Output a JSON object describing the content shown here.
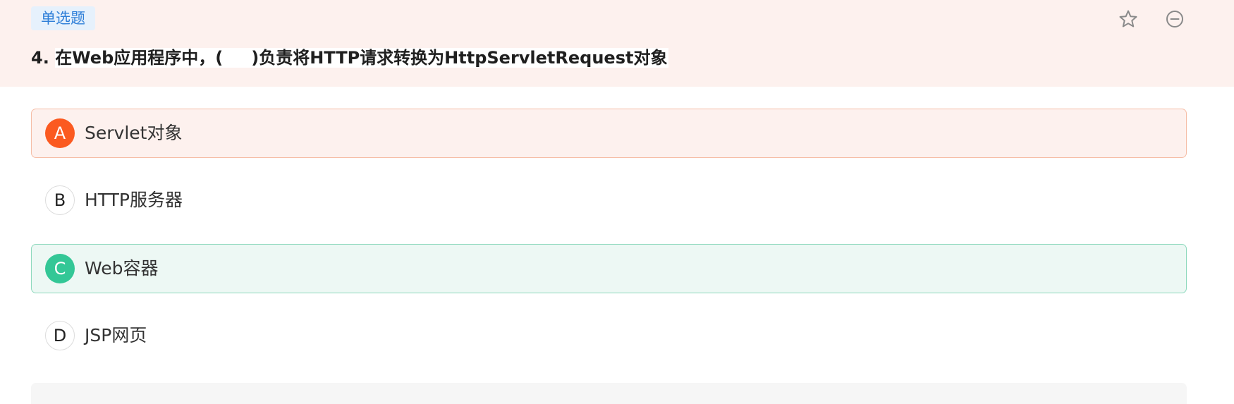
{
  "header": {
    "question_type": "单选题",
    "question_number": "4.",
    "question_before": "在Web应用程序中，(",
    "question_after": ")负责将HTTP请求转换为HttpServletRequest对象"
  },
  "options": [
    {
      "letter": "A",
      "text": "Servlet对象",
      "state": "wrong"
    },
    {
      "letter": "B",
      "text": "HTTP服务器",
      "state": "normal"
    },
    {
      "letter": "C",
      "text": "Web容器",
      "state": "correct"
    },
    {
      "letter": "D",
      "text": "JSP网页",
      "state": "normal"
    }
  ],
  "colors": {
    "header_bg": "#fdf1ee",
    "wrong_accent": "#fb5a20",
    "correct_accent": "#33c796",
    "badge_text": "#2f7fd8"
  },
  "icons": [
    "star-icon",
    "remove-icon"
  ]
}
